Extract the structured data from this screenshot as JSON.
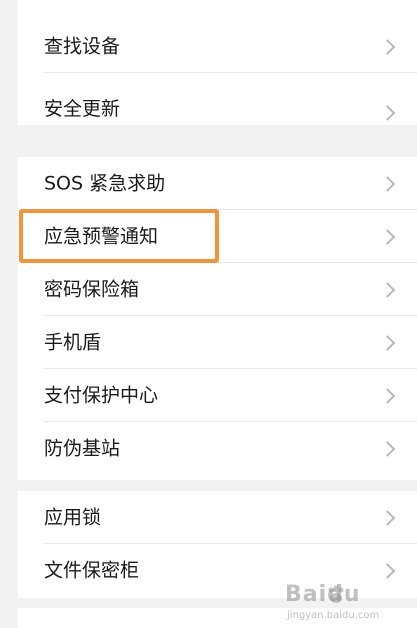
{
  "group1": {
    "items": [
      {
        "label": "查找设备"
      },
      {
        "label": "安全更新"
      }
    ]
  },
  "group2": {
    "items": [
      {
        "label": "SOS 紧急求助"
      },
      {
        "label": "应急预警通知"
      },
      {
        "label": "密码保险箱"
      },
      {
        "label": "手机盾"
      },
      {
        "label": "支付保护中心"
      },
      {
        "label": "防伪基站"
      }
    ]
  },
  "group3": {
    "items": [
      {
        "label": "应用锁"
      },
      {
        "label": "文件保密柜"
      }
    ]
  },
  "highlight_color": "#f0953a",
  "icon": "chevron-right-icon",
  "watermark": {
    "logo": "Baidu",
    "site": "jingyan.baidu.com"
  }
}
